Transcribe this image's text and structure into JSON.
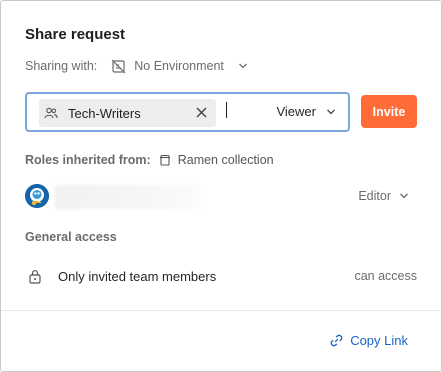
{
  "dialog": {
    "title": "Share request"
  },
  "sharing": {
    "label": "Sharing with:",
    "environment": "No Environment",
    "environment_icon": "no-environment-icon"
  },
  "invite": {
    "chip_label": "Tech-Writers",
    "chip_icon": "group-icon",
    "role": "Viewer",
    "button_label": "Invite",
    "accent_color": "#ff6c37",
    "focus_border_color": "#7aa7e0"
  },
  "inherited": {
    "label": "Roles inherited from:",
    "collection": "Ramen collection",
    "collection_icon": "collection-icon"
  },
  "member": {
    "name": "",
    "role": "Editor"
  },
  "general_access": {
    "heading": "General access",
    "scope": "Only invited team members",
    "permission": "can access"
  },
  "footer": {
    "copy_link_label": "Copy Link",
    "link_color": "#1a64c9"
  }
}
